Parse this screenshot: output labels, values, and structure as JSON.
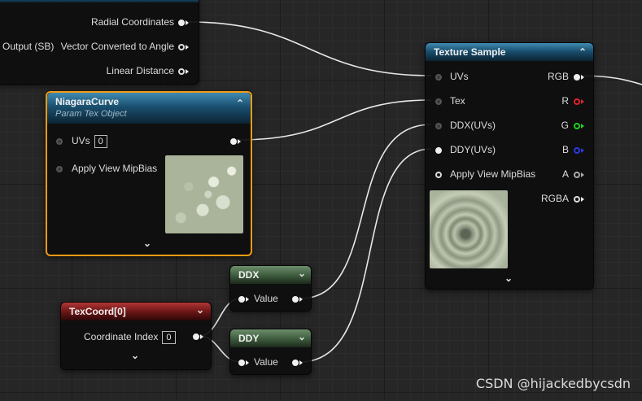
{
  "top_node": {
    "rows": [
      "Radial Coordinates",
      "Vector Converted to Angle",
      "Linear Distance"
    ],
    "left_label": "Output (SB)"
  },
  "texture_sample": {
    "title": "Texture Sample",
    "inputs": [
      "UVs",
      "Tex",
      "DDX(UVs)",
      "DDY(UVs)",
      "Apply View MipBias"
    ],
    "outputs": [
      "RGB",
      "R",
      "G",
      "B",
      "A",
      "RGBA"
    ]
  },
  "niagara_curve": {
    "title": "NiagaraCurve",
    "subtitle": "Param Tex Object",
    "uvs_label": "UVs",
    "uvs_value": "0",
    "mip_label": "Apply View MipBias"
  },
  "texcoord": {
    "title": "TexCoord[0]",
    "index_label": "Coordinate Index",
    "index_value": "0"
  },
  "ddx": {
    "title": "DDX",
    "value_label": "Value"
  },
  "ddy": {
    "title": "DDY",
    "value_label": "Value"
  },
  "watermark": "CSDN @hijackedbycsdn",
  "colors": {
    "selected_border": "#f39a12",
    "pin_r": "#e0202a",
    "pin_g": "#20d020",
    "pin_b": "#2a3ae0"
  }
}
